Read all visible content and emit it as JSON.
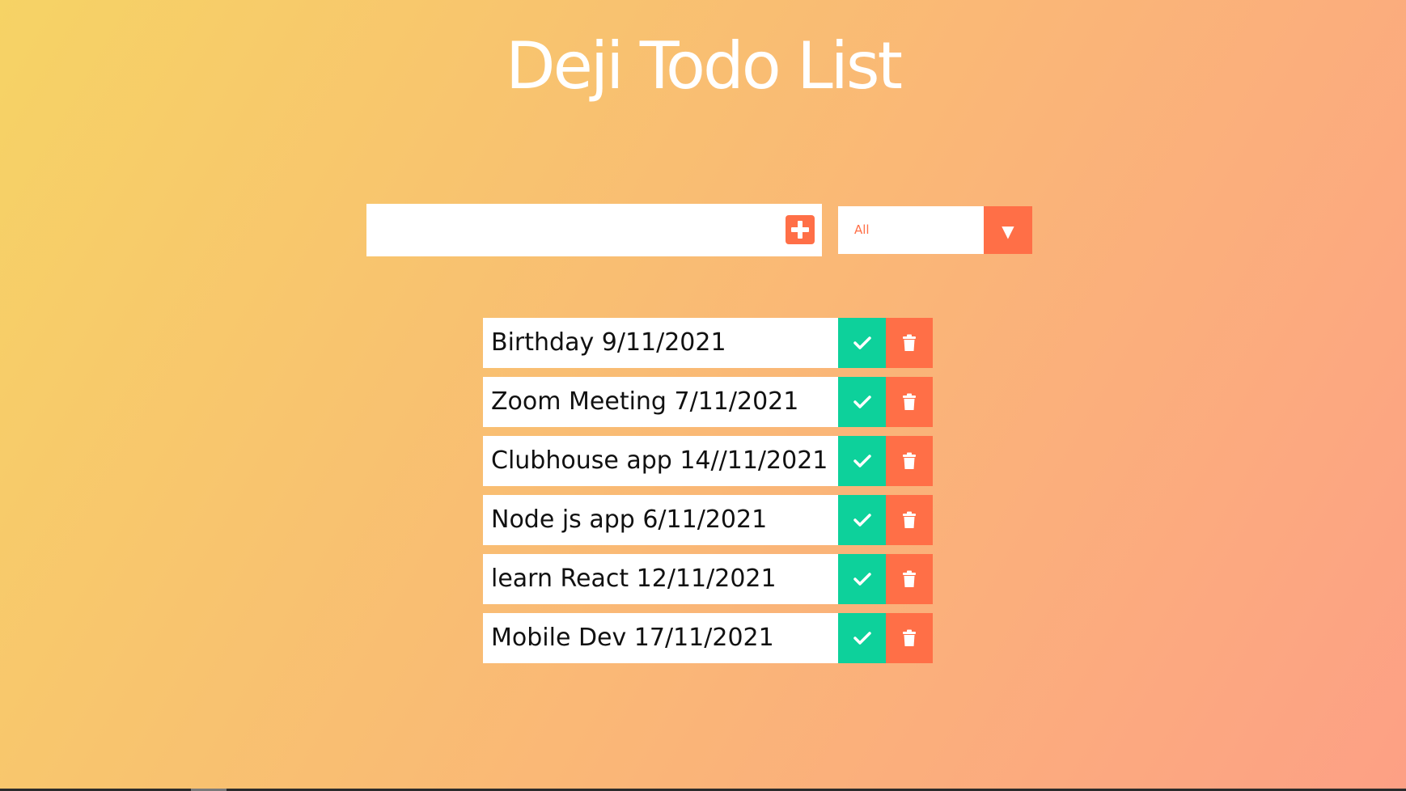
{
  "app": {
    "title": "Deji Todo List"
  },
  "input": {
    "value": "",
    "add_icon": "plus-square-icon"
  },
  "filter": {
    "selected": "All",
    "arrow_glyph": "▼"
  },
  "todos": [
    {
      "text": "Birthday 9/11/2021"
    },
    {
      "text": "Zoom Meeting 7/11/2021"
    },
    {
      "text": "Clubhouse app 14//11/2021"
    },
    {
      "text": "Node js app 6/11/2021"
    },
    {
      "text": "learn React 12/11/2021"
    },
    {
      "text": "Mobile Dev 17/11/2021"
    }
  ],
  "icons": {
    "complete": "check-icon",
    "delete": "trash-icon"
  },
  "colors": {
    "gradient_start": "#f6d365",
    "gradient_end": "#fda085",
    "accent": "#ff6f47",
    "complete": "#0dd19b"
  }
}
